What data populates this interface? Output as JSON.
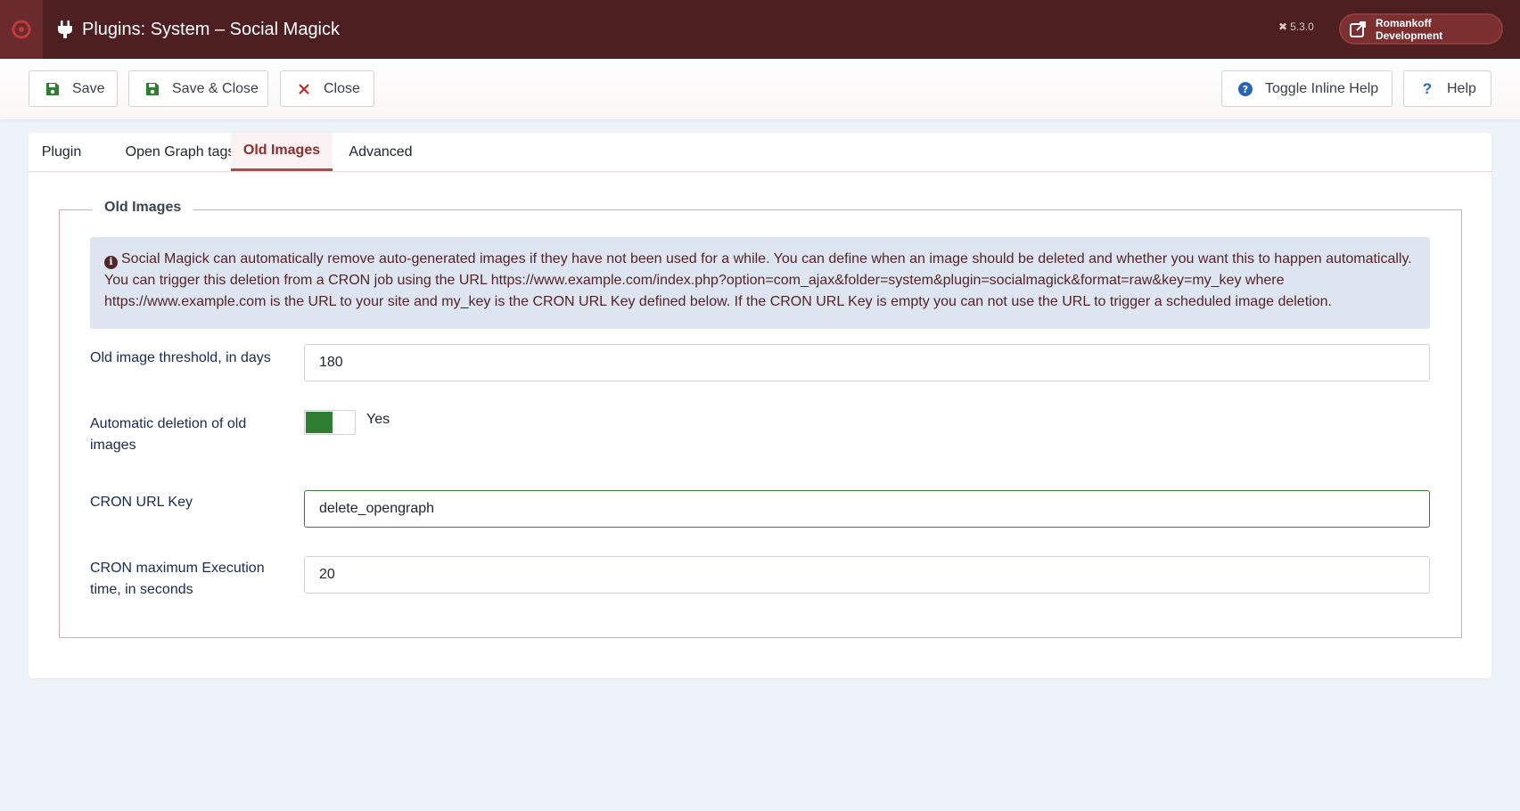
{
  "header": {
    "title": "Plugins: System – Social Magick",
    "version": "5.3.0",
    "site_button": "Romankoff Development"
  },
  "toolbar": {
    "save": "Save",
    "save_close": "Save & Close",
    "close": "Close",
    "toggle_help": "Toggle Inline Help",
    "help": "Help"
  },
  "tabs": [
    "Plugin",
    "Open Graph tags",
    "Old Images",
    "Advanced"
  ],
  "active_tab": "Old Images",
  "fieldset": {
    "legend": "Old Images",
    "info": "Social Magick can automatically remove auto-generated images if they have not been used for a while. You can define when an image should be deleted and whether you want this to happen automatically. You can trigger this deletion from a CRON job using the URL https://www.example.com/index.php?option=com_ajax&folder=system&plugin=socialmagick&format=raw&key=my_key where https://www.example.com is the URL to your site and my_key is the CRON URL Key defined below. If the CRON URL Key is empty you can not use the URL to trigger a scheduled image deletion."
  },
  "fields": {
    "threshold_label": "Old image threshold, in days",
    "threshold_value": "180",
    "autodelete_label": "Automatic deletion of old images",
    "autodelete_value": "Yes",
    "cron_key_label": "CRON URL Key",
    "cron_key_value": "delete_opengraph",
    "cron_time_label": "CRON maximum Execution time, in seconds",
    "cron_time_value": "20"
  },
  "colors": {
    "header_bg": "#4d1f21",
    "accent": "#8b2f31",
    "toggle_on": "#2f7d32",
    "alert_bg": "#dde5f0"
  }
}
